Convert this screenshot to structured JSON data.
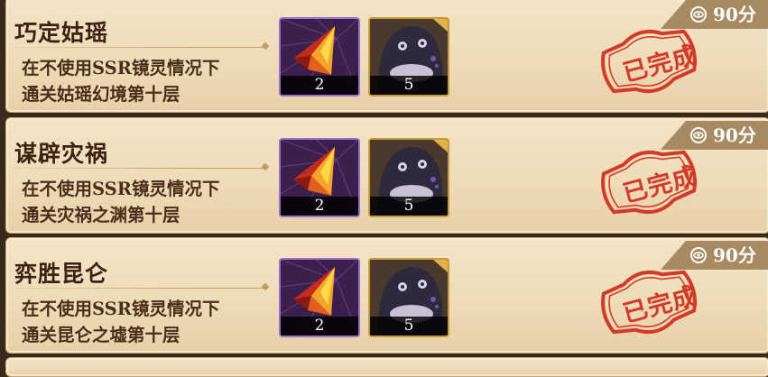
{
  "colors": {
    "card_bg": "#f0dfbd",
    "title_text": "#3b2212",
    "stamp_red": "#d23a2a",
    "score_tab": "#a88a62",
    "purple_frame": "#9a70c8",
    "gold_frame": "#c79a3a"
  },
  "reward_icons": [
    "red-gold-crystal-icon",
    "dark-slime-creature-icon"
  ],
  "score_icon": "eye-badge-icon",
  "achievements": [
    {
      "title": "巧定姑瑶",
      "desc_line1": "在不使用SSR镜灵情况下",
      "desc_line2": "通关姑瑶幻境第十层",
      "rewards": [
        {
          "icon": "red-gold-crystal-icon",
          "count": "2"
        },
        {
          "icon": "dark-slime-creature-icon",
          "count": "5"
        }
      ],
      "score": "90分",
      "status": "已完成"
    },
    {
      "title": "谋辟灾祸",
      "desc_line1": "在不使用SSR镜灵情况下",
      "desc_line2": "通关灾祸之渊第十层",
      "rewards": [
        {
          "icon": "red-gold-crystal-icon",
          "count": "2"
        },
        {
          "icon": "dark-slime-creature-icon",
          "count": "5"
        }
      ],
      "score": "90分",
      "status": "已完成"
    },
    {
      "title": "弈胜昆仑",
      "desc_line1": "在不使用SSR镜灵情况下",
      "desc_line2": "通关昆仑之墟第十层",
      "rewards": [
        {
          "icon": "red-gold-crystal-icon",
          "count": "2"
        },
        {
          "icon": "dark-slime-creature-icon",
          "count": "5"
        }
      ],
      "score": "90分",
      "status": "已完成"
    }
  ]
}
